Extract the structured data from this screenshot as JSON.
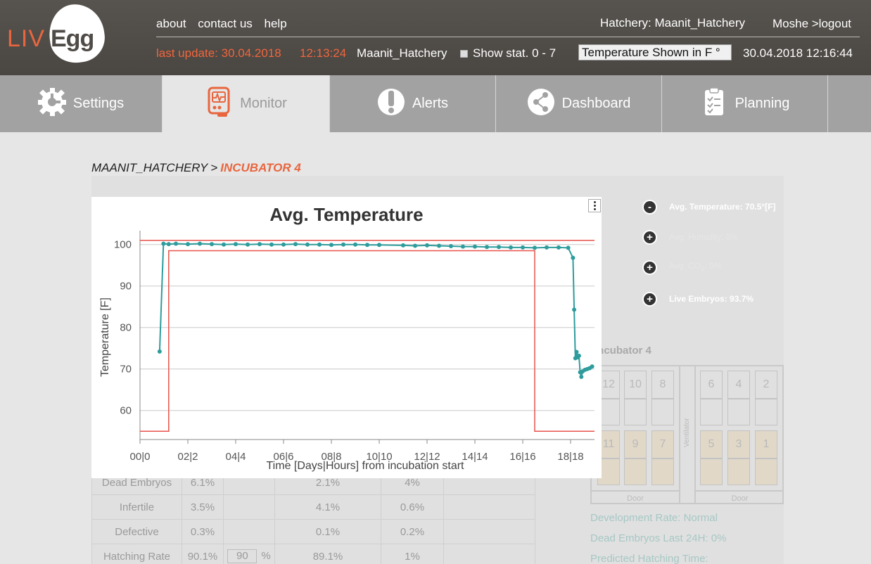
{
  "header": {
    "logo_liv": "LIV",
    "logo_egg": "Egg",
    "links": [
      "about",
      "contact us",
      "help"
    ],
    "hatchery_label": "Hatchery:  Maanit_Hatchery",
    "user": "Moshe",
    "logout": " >logout",
    "last_update": "last update: 30.04.2018",
    "last_update_time": "12:13:24",
    "hatchery_name": "Maanit_Hatchery",
    "show_stat": "Show stat. 0 - 7",
    "temp_select": "Temperature Shown in  F °",
    "current_datetime": "30.04.2018 12:16:44"
  },
  "nav": {
    "tabs": [
      {
        "label": "Settings",
        "icon": "gear-icon"
      },
      {
        "label": "Monitor",
        "icon": "monitor-icon"
      },
      {
        "label": "Alerts",
        "icon": "alert-icon"
      },
      {
        "label": "Dashboard",
        "icon": "share-icon"
      },
      {
        "label": "Planning",
        "icon": "clipboard-icon"
      }
    ]
  },
  "breadcrumb": {
    "root": "MAANIT_HATCHERY",
    "separator": ">",
    "current": "INCUBATOR 4"
  },
  "legend": [
    {
      "label": "Avg. Temperature: 70.5°[F]",
      "state": "-"
    },
    {
      "label": "Avg. Humidity: 0%",
      "state": "+"
    },
    {
      "label_pre": "Avg. CO",
      "label_sub": "2",
      "label_post": ": 0%",
      "state": "+"
    },
    {
      "label": "Live Embryos: 93.7%",
      "state": "+"
    }
  ],
  "stats_table": {
    "rows": [
      {
        "name": "Dead Embryos",
        "v1": "6.1%",
        "v2": "",
        "v3": "2.1%",
        "v4": "4%"
      },
      {
        "name": "Infertile",
        "v1": "3.5%",
        "v2": "",
        "v3": "4.1%",
        "v4": "0.6%"
      },
      {
        "name": "Defective",
        "v1": "0.3%",
        "v2": "",
        "v3": "0.1%",
        "v4": "0.2%"
      },
      {
        "name": "Hatching Rate",
        "v1": "90.1%",
        "v2": "90",
        "v2_unit": "%",
        "v3": "89.1%",
        "v4": "1%"
      }
    ]
  },
  "incubator": {
    "title": "Incubator 4",
    "ventilator": "Ventilator",
    "door_left": "Door",
    "door_right": "Door",
    "top_slots_left": [
      "12",
      "10",
      "8"
    ],
    "top_slots_right": [
      "6",
      "4",
      "2"
    ],
    "bot_slots_left": [
      "11",
      "9",
      "7"
    ],
    "bot_slots_right": [
      "5",
      "3",
      "1"
    ]
  },
  "info": {
    "development_rate": "Development Rate: Normal",
    "dead_embryos_24h": "Dead Embryos Last 24H: 0%",
    "predicted_hatching": "Predicted Hatching Time:"
  },
  "chart_data": {
    "type": "line",
    "title": "Avg. Temperature",
    "xlabel": "Time [Days|Hours] from incubation start",
    "ylabel": "Temperature [F]",
    "xlim": [
      0,
      19
    ],
    "ylim": [
      53,
      103
    ],
    "yticks": [
      60,
      70,
      80,
      90,
      100
    ],
    "xticks": [
      {
        "v": 0,
        "label": "00|0"
      },
      {
        "v": 2,
        "label": "02|2"
      },
      {
        "v": 4,
        "label": "04|4"
      },
      {
        "v": 6,
        "label": "06|6"
      },
      {
        "v": 8,
        "label": "08|8"
      },
      {
        "v": 10,
        "label": "10|10"
      },
      {
        "v": 12,
        "label": "12|12"
      },
      {
        "v": 14,
        "label": "14|14"
      },
      {
        "v": 16,
        "label": "16|16"
      },
      {
        "v": 18,
        "label": "18|18"
      }
    ],
    "series": [
      {
        "color": "#2e9c9c",
        "x": [
          0.82,
          0.98,
          1.2,
          1.5,
          2.0,
          2.5,
          3.0,
          3.5,
          4.0,
          4.5,
          5.0,
          5.5,
          6.0,
          6.5,
          7.0,
          7.5,
          8.0,
          8.5,
          9.0,
          9.5,
          10.0,
          11.0,
          11.5,
          12.0,
          12.5,
          13.0,
          13.5,
          14.0,
          14.5,
          15.0,
          15.5,
          16.0,
          16.5,
          17.0,
          17.5,
          17.9,
          18.1,
          18.15,
          18.2,
          18.25,
          18.3,
          18.35,
          18.4,
          18.45,
          18.5,
          18.6,
          18.7,
          18.8,
          18.9
        ],
        "y": [
          74.2,
          100.2,
          100.1,
          100.2,
          100.1,
          100.2,
          100.1,
          100.0,
          100.1,
          100.0,
          100.1,
          100.0,
          100.0,
          100.1,
          100.0,
          100.0,
          99.9,
          100.0,
          100.0,
          99.9,
          99.9,
          99.8,
          99.7,
          99.8,
          99.7,
          99.6,
          99.5,
          99.5,
          99.4,
          99.4,
          99.3,
          99.3,
          99.2,
          99.3,
          99.3,
          99.2,
          96.8,
          84.3,
          72.6,
          74.1,
          72.8,
          73.2,
          69.2,
          68.1,
          69.4,
          69.8,
          70.0,
          70.2,
          70.6
        ]
      },
      {
        "color": "#e8524a",
        "x": [
          0,
          1.2,
          1.2,
          16.5,
          16.5,
          19
        ],
        "y": [
          55,
          55,
          98.5,
          98.5,
          55,
          55
        ]
      },
      {
        "color": "#e8524a",
        "x": [
          0,
          19
        ],
        "y": [
          101,
          101
        ]
      }
    ]
  }
}
